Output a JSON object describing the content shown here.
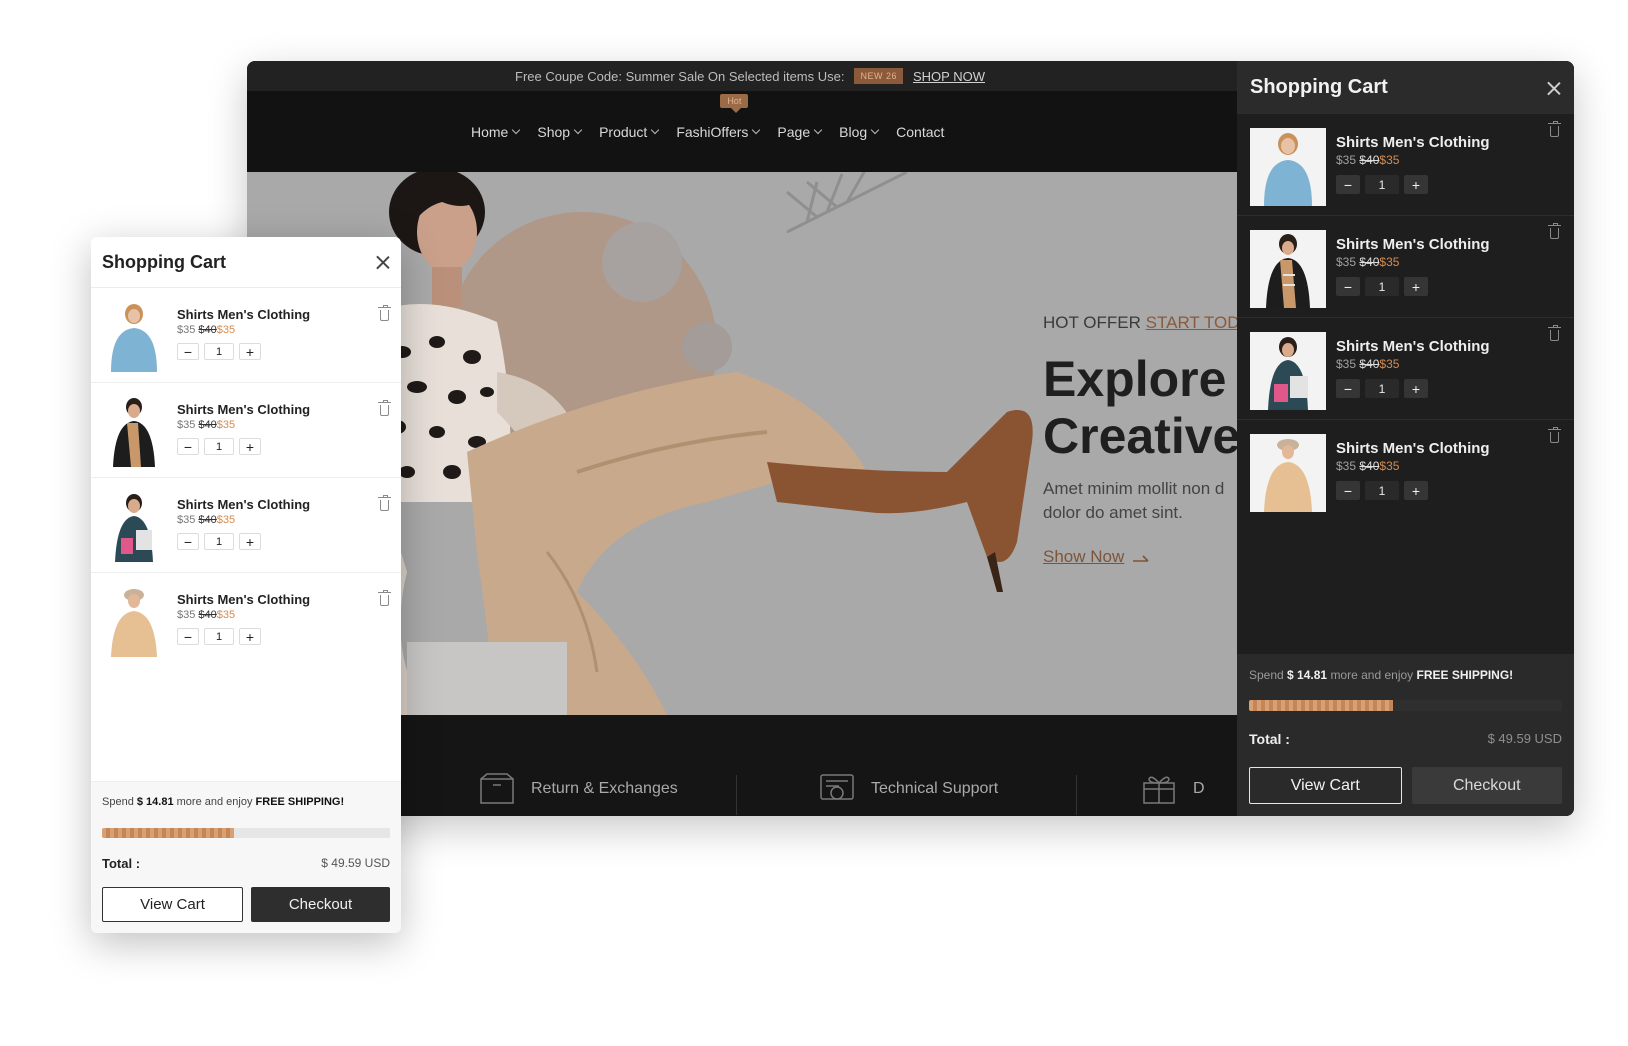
{
  "topbar": {
    "promo_text": "Free Coupe Code: Summer Sale On Selected items Use:",
    "coupon_code": "NEW 26",
    "shop_now": "SHOP NOW"
  },
  "nav": {
    "hot_badge": "Hot",
    "items": [
      {
        "label": "Home",
        "dropdown": true
      },
      {
        "label": "Shop",
        "dropdown": true
      },
      {
        "label": "Product",
        "dropdown": true
      },
      {
        "label": "FashiOffers",
        "dropdown": true
      },
      {
        "label": "Page",
        "dropdown": true
      },
      {
        "label": "Blog",
        "dropdown": true
      },
      {
        "label": "Contact",
        "dropdown": false
      }
    ]
  },
  "hero": {
    "kicker": "HOT OFFER",
    "kicker_link": "START TODA",
    "headline_line1": "Explore Y",
    "headline_line2": "Creative",
    "body_line1": "Amet minim mollit non d",
    "body_line2": "dolor do amet sint.",
    "cta": "Show Now"
  },
  "features": [
    {
      "label": "Return & Exchanges",
      "icon": "box-return-icon"
    },
    {
      "label": "Technical Support",
      "icon": "support-icon"
    },
    {
      "label": "D",
      "icon": "gift-icon"
    }
  ],
  "cart": {
    "title": "Shopping Cart",
    "items": [
      {
        "name": "Shirts Men's Clothing",
        "price": "$35",
        "old_price": "$40",
        "sale_price": "$35",
        "qty": "1",
        "image": "blue-sweater-woman"
      },
      {
        "name": "Shirts Men's Clothing",
        "price": "$35",
        "old_price": "$40",
        "sale_price": "$35",
        "qty": "1",
        "image": "man-with-scarf"
      },
      {
        "name": "Shirts Men's Clothing",
        "price": "$35",
        "old_price": "$40",
        "sale_price": "$35",
        "qty": "1",
        "image": "woman-with-pink-bag"
      },
      {
        "name": "Shirts Men's Clothing",
        "price": "$35",
        "old_price": "$40",
        "sale_price": "$35",
        "qty": "1",
        "image": "woman-beige-tshirt"
      }
    ],
    "minus": "−",
    "plus": "+",
    "shipping_prefix": "Spend",
    "shipping_amount": "$ 14.81",
    "shipping_middle": "more and enjoy",
    "shipping_free": "FREE SHIPPING!",
    "shipping_progress": 0.46,
    "total_label": "Total :",
    "total_value": "$ 49.59 USD",
    "view_cart": "View Cart",
    "checkout": "Checkout"
  },
  "colors": {
    "accent": "#8a5a3a",
    "sale": "#d68b4e",
    "progress": "#d9a173",
    "dark_bg": "#151515",
    "drawer_bg": "#1e1e1e"
  }
}
